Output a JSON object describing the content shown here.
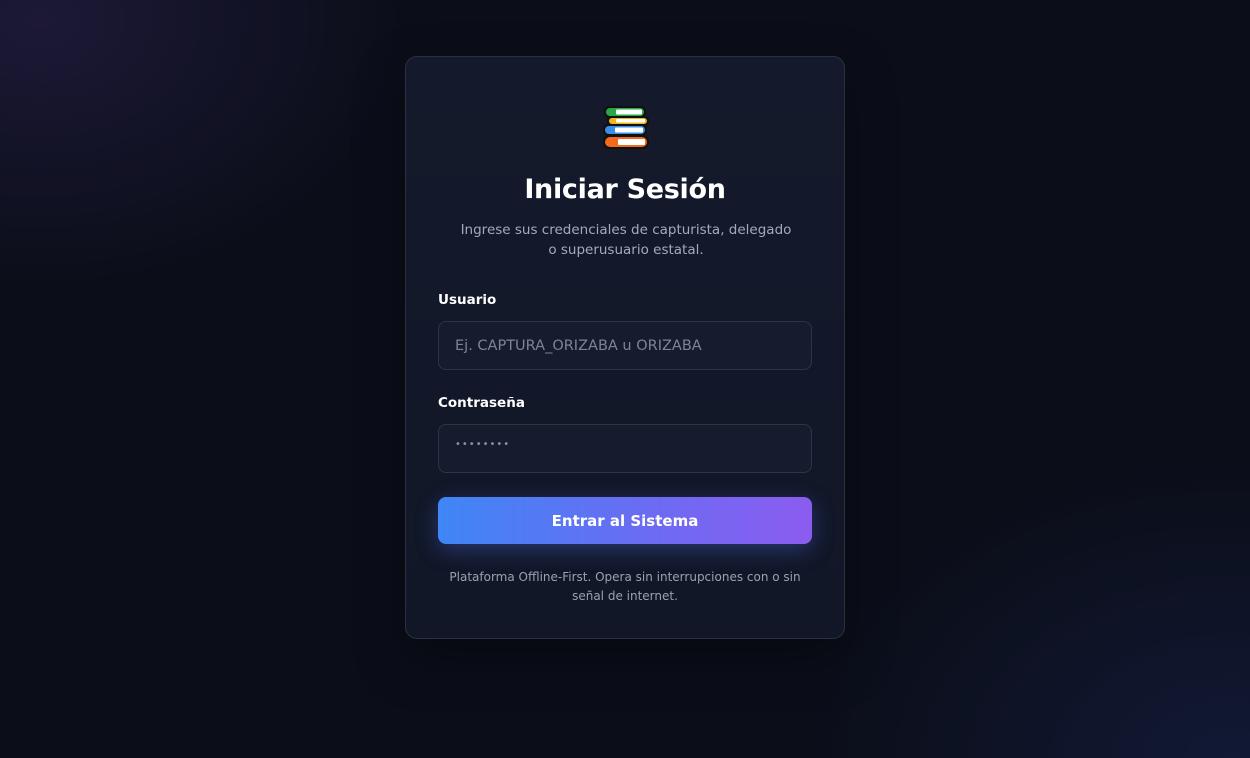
{
  "login": {
    "logo_icon": "books-stack-icon",
    "title": "Iniciar Sesión",
    "subtitle": "Ingrese sus credenciales de capturista, delegado o superusuario estatal.",
    "username": {
      "label": "Usuario",
      "placeholder": "Ej. CAPTURA_ORIZABA u ORIZABA",
      "value": ""
    },
    "password": {
      "label": "Contraseña",
      "masked_value": "••••••••"
    },
    "submit_label": "Entrar al Sistema",
    "footer": "Plataforma Offline-First. Opera sin interrupciones con o sin señal de internet."
  },
  "colors": {
    "background": "#0b0e19",
    "card": "#141a2b",
    "accent_start": "#3f86f6",
    "accent_end": "#8b5cf0"
  }
}
